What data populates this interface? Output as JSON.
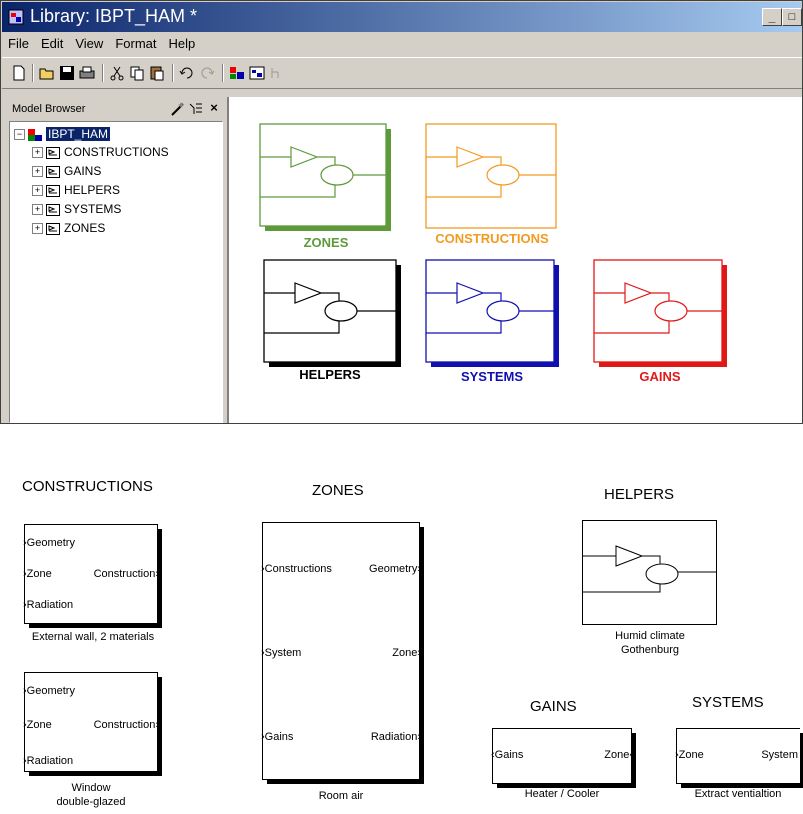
{
  "window": {
    "title": "Library: IBPT_HAM *",
    "controls": [
      "_",
      "□",
      "x"
    ]
  },
  "menu": [
    "File",
    "Edit",
    "View",
    "Format",
    "Help"
  ],
  "browser": {
    "label": "Model Browser",
    "root": "IBPT_HAM",
    "items": [
      "CONSTRUCTIONS",
      "GAINS",
      "HELPERS",
      "SYSTEMS",
      "ZONES"
    ]
  },
  "canvas": {
    "blocks": [
      {
        "name": "ZONES",
        "color": "#5e9a3c"
      },
      {
        "name": "CONSTRUCTIONS",
        "color": "#f39a1f"
      },
      {
        "name": "HELPERS",
        "color": "#000000"
      },
      {
        "name": "SYSTEMS",
        "color": "#1010b0"
      },
      {
        "name": "GAINS",
        "color": "#e11818"
      }
    ]
  },
  "bottom": {
    "constructions": {
      "header": "CONSTRUCTIONS",
      "block1": {
        "in": [
          "Geometry",
          "Zone",
          "Radiation"
        ],
        "out": "Construction",
        "caption": "External wall, 2 materials"
      },
      "block2": {
        "in": [
          "Geometry",
          "Zone",
          "Radiation"
        ],
        "out": "Construction",
        "caption1": "Window",
        "caption2": "double-glazed"
      }
    },
    "zones": {
      "header": "ZONES",
      "in": [
        "Constructions",
        "System",
        "Gains"
      ],
      "out": [
        "Geometry",
        "Zone",
        "Radiation"
      ],
      "caption": "Room air"
    },
    "helpers": {
      "header": "HELPERS",
      "caption1": "Humid climate",
      "caption2": "Gothenburg"
    },
    "gains": {
      "header": "GAINS",
      "in": "Gains",
      "out": "Zone",
      "caption": "Heater / Cooler"
    },
    "systems": {
      "header": "SYSTEMS",
      "in": "Zone",
      "out": "System",
      "caption": "Extract ventialtion"
    }
  }
}
